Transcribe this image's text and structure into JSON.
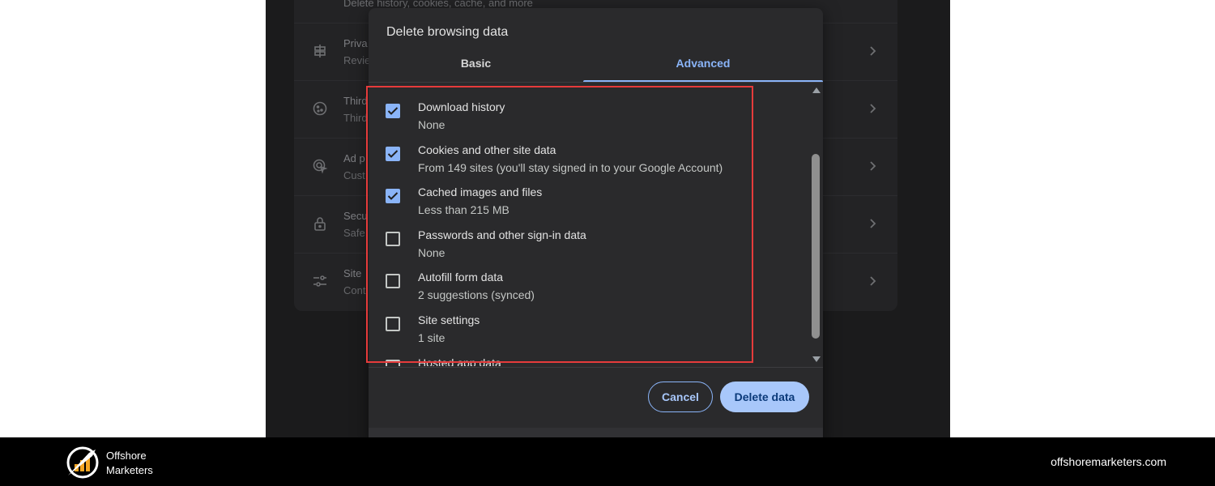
{
  "background_settings": {
    "top_text": "Delete history, cookies, cache, and more",
    "rows": [
      {
        "title": "Priva",
        "sub": "Revie",
        "icon": "privacy-guide-icon"
      },
      {
        "title": "Third",
        "sub": "Third",
        "icon": "cookie-icon"
      },
      {
        "title": "Ad p",
        "sub": "Cust",
        "icon": "ad-privacy-icon"
      },
      {
        "title": "Secu",
        "sub": "Safe",
        "icon": "lock-icon"
      },
      {
        "title": "Site",
        "sub": "Cont",
        "icon": "site-settings-icon"
      }
    ]
  },
  "dialog": {
    "title": "Delete browsing data",
    "tabs": [
      {
        "label": "Basic",
        "active": false
      },
      {
        "label": "Advanced",
        "active": true
      }
    ],
    "items": [
      {
        "title": "Download history",
        "sub": "None",
        "checked": true
      },
      {
        "title": "Cookies and other site data",
        "sub": "From 149 sites (you'll stay signed in to your Google Account)",
        "checked": true
      },
      {
        "title": "Cached images and files",
        "sub": "Less than 215 MB",
        "checked": true
      },
      {
        "title": "Passwords and other sign-in data",
        "sub": "None",
        "checked": false
      },
      {
        "title": "Autofill form data",
        "sub": "2 suggestions (synced)",
        "checked": false
      },
      {
        "title": "Site settings",
        "sub": "1 site",
        "checked": false
      },
      {
        "title": "Hosted app data",
        "sub": "",
        "checked": false
      }
    ],
    "cancel_label": "Cancel",
    "delete_label": "Delete data"
  },
  "colors": {
    "accent": "#8ab4f8",
    "highlight": "#e63b3b",
    "dialog_bg": "#2a2a2c"
  },
  "brand": {
    "name_line1": "Offshore",
    "name_line2": "Marketers",
    "url": "offshoremarketers.com"
  }
}
